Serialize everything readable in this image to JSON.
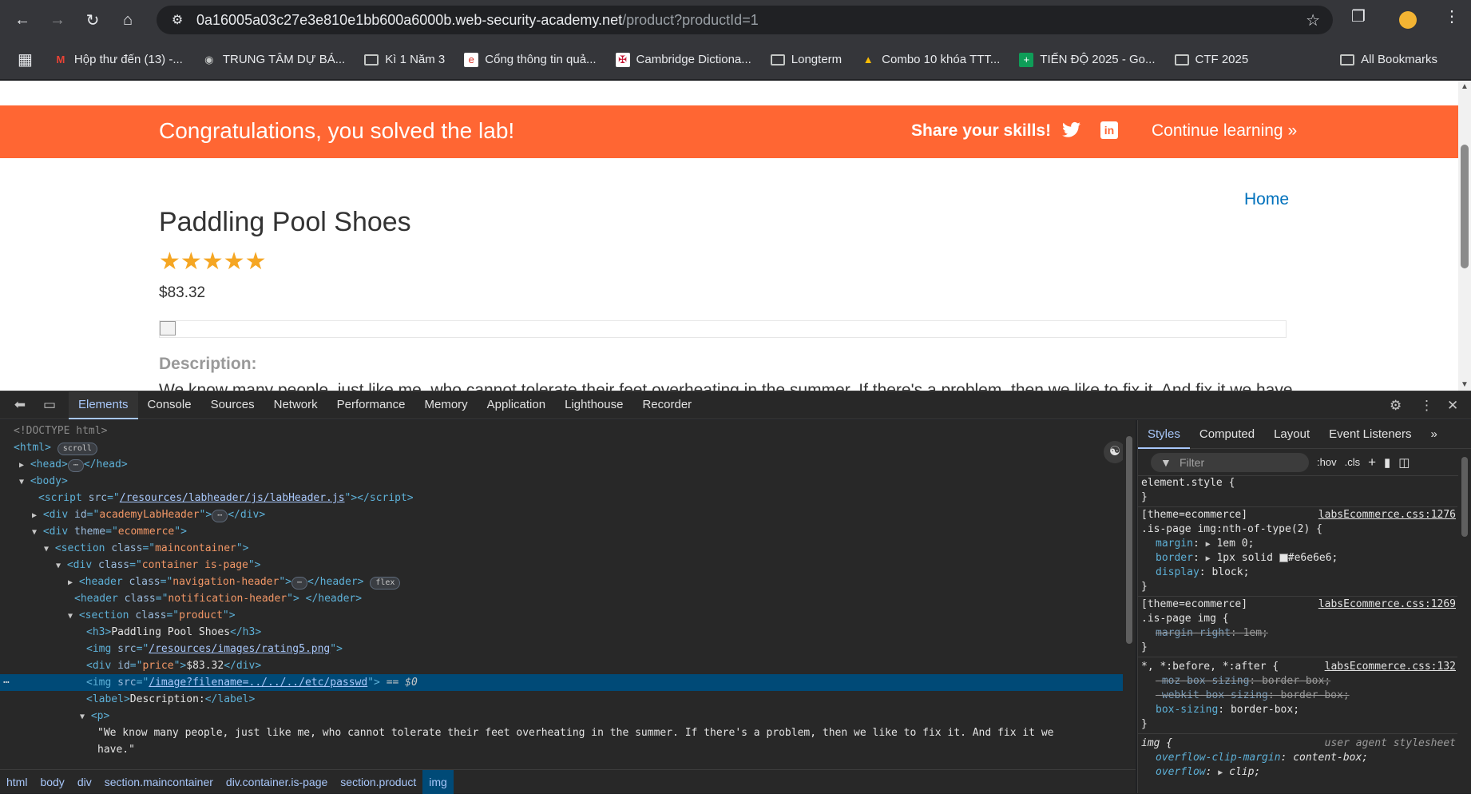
{
  "browser": {
    "url_host": "0a16005a03c27e3e810e1bb600a6000b.web-security-academy.net",
    "url_path": "/product?productId=1",
    "bookmarks": [
      {
        "label": "Hộp thư đến (13) -...",
        "icon": "gmail-icon"
      },
      {
        "label": "TRUNG TÂM DỰ BÁ...",
        "icon": "globe-icon"
      },
      {
        "label": "Kì 1 Năm 3",
        "icon": "folder-icon"
      },
      {
        "label": "Cổng thông tin quả...",
        "icon": "portal-icon"
      },
      {
        "label": "Cambridge Dictiona...",
        "icon": "cambridge-icon"
      },
      {
        "label": "Longterm",
        "icon": "folder-icon"
      },
      {
        "label": "Combo 10 khóa TTT...",
        "icon": "drive-icon"
      },
      {
        "label": "TIẾN ĐỘ 2025 - Go...",
        "icon": "sheets-icon"
      },
      {
        "label": "CTF 2025",
        "icon": "folder-icon"
      }
    ],
    "all_bookmarks": "All Bookmarks"
  },
  "page": {
    "banner_message": "Congratulations, you solved the lab!",
    "share_label": "Share your skills!",
    "continue_label": "Continue learning",
    "home_link": "Home",
    "product_title": "Paddling Pool Shoes",
    "rating_stars": 5,
    "stars_text": "★★★★★",
    "price": "$83.32",
    "description_label": "Description:",
    "description_text": "We know many people, just like me, who cannot tolerate their feet overheating in the summer. If there's a problem, then we like to fix it. And fix it we have."
  },
  "devtools": {
    "tabs": [
      "Elements",
      "Console",
      "Sources",
      "Network",
      "Performance",
      "Memory",
      "Application",
      "Lighthouse",
      "Recorder"
    ],
    "active_tab": "Elements",
    "dom": {
      "doctype": "<!DOCTYPE html>",
      "html_tag": "<html>",
      "scroll_badge": "scroll",
      "head": "<head>",
      "head_close": "</head>",
      "body": "<body>",
      "script_src": "/resources/labheader/js/labHeader.js",
      "div_id": "academyLabHeader",
      "div_theme": "ecommerce",
      "section_class": "maincontainer",
      "div_class": "container is-page",
      "header_class": "navigation-header",
      "flex_badge": "flex",
      "header2_class": "notification-header",
      "product_section_class": "product",
      "h3_text": "Paddling Pool Shoes",
      "img_rating_src": "/resources/images/rating5.png",
      "price_id": "price",
      "price_text": "$83.32",
      "img_selected_src": "/image?filename=../../../etc/passwd",
      "selected_marker": "== $0",
      "label_text": "Description:",
      "p_text_1": "\"We know many people, just like me, who cannot tolerate their feet overheating in the summer. If there's a problem, then we like to fix it. And fix it we",
      "p_text_2": "have.\""
    },
    "breadcrumbs": [
      "html",
      "body",
      "div",
      "section.maincontainer",
      "div.container.is-page",
      "section.product",
      "img"
    ],
    "styles_tabs": [
      "Styles",
      "Computed",
      "Layout",
      "Event Listeners"
    ],
    "filter_placeholder": "Filter",
    "hov": ":hov",
    "cls": ".cls",
    "rules": {
      "element_style": "element.style {",
      "r1_selector_a": "[theme=ecommerce]",
      "r1_selector_b": ".is-page img:nth-of-type(2) {",
      "r1_source": "labsEcommerce.css:1276",
      "r1_margin": "1em 0;",
      "r1_border": "1px solid",
      "r1_border_color": "#e6e6e6;",
      "r1_display": "block;",
      "r2_selector_a": "[theme=ecommerce]",
      "r2_selector_b": ".is-page img {",
      "r2_source": "labsEcommerce.css:1269",
      "r2_margin_right": "1em;",
      "r3_selector": "*, *:before, *:after {",
      "r3_source": "labsEcommerce.css:132",
      "r3_moz": "border-box;",
      "r3_webkit": "border-box;",
      "r3_box": "border-box;",
      "r4_selector": "img {",
      "r4_source": "user agent stylesheet",
      "r4_overflow_clip": "content-box;",
      "r4_overflow": "clip;"
    }
  }
}
